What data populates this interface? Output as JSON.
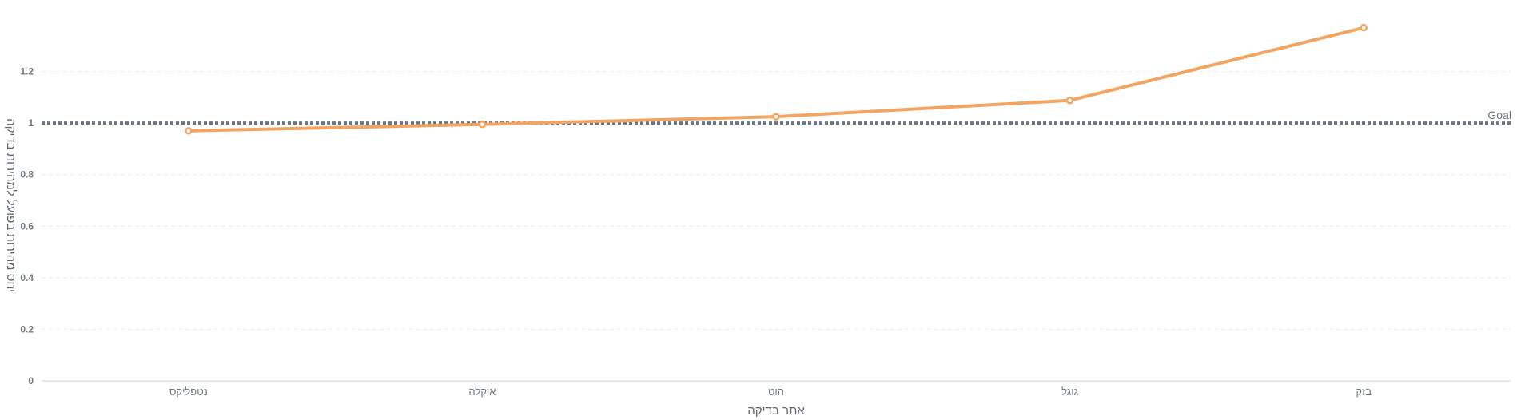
{
  "chart_data": {
    "type": "line",
    "categories": [
      "נטפליקס",
      "אוקלה",
      "הוט",
      "גוגל",
      "בזק"
    ],
    "series": [
      {
        "values": [
          0.97,
          0.995,
          1.025,
          1.088,
          1.37
        ],
        "color": "#f2a563"
      }
    ],
    "xlabel": "אתר בדיקה",
    "ylabel": "יחס מהירות בפועל למהירות בדיקה",
    "ylim": [
      0,
      1.4
    ],
    "yticks": [
      "0",
      "0.2",
      "0.4",
      "0.6",
      "0.8",
      "1",
      "1.2"
    ],
    "goal": {
      "value": 1,
      "label": "Goal",
      "color": "#6b7684"
    },
    "grid": true
  }
}
